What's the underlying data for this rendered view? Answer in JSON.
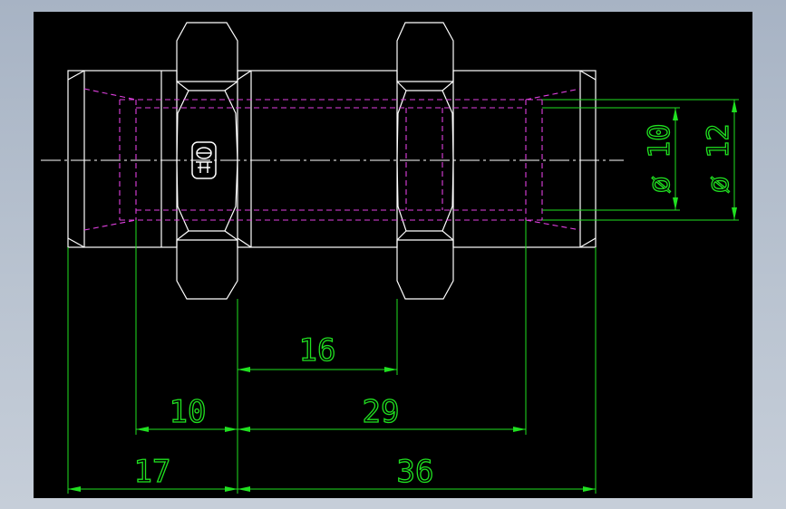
{
  "drawing": {
    "background": "#000000",
    "colors": {
      "outline": "#ffffff",
      "hidden": "#e040e0",
      "dimension": "#20e020",
      "centerline": "#ffffff"
    },
    "dimensions": {
      "d16": "16",
      "d10": "10",
      "d29": "29",
      "d17": "17",
      "d36": "36",
      "dia10": "ø 10",
      "dia12": "ø 12"
    },
    "logo": "company-logo"
  }
}
